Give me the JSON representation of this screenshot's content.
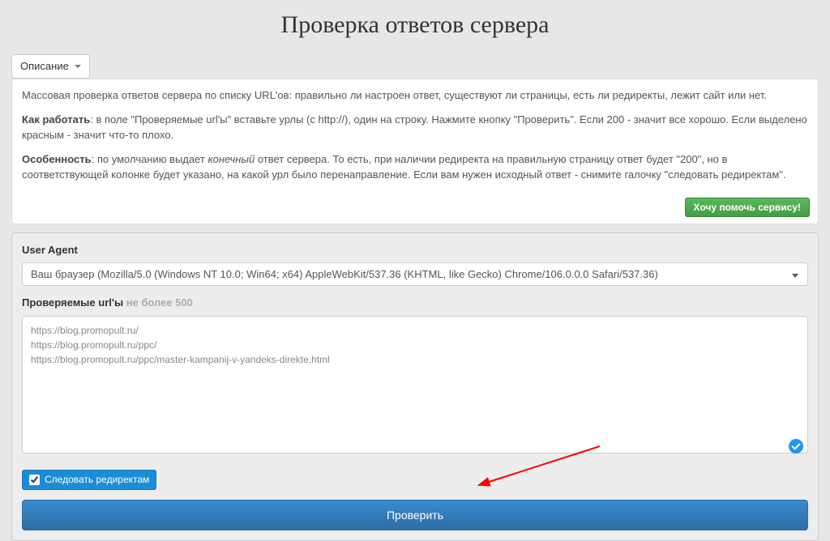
{
  "page": {
    "title": "Проверка ответов сервера"
  },
  "description": {
    "dropdown_label": "Описание",
    "p1_pre": "Массовая проверка ответов сервера по списку URL'ов: правильно ли настроен ответ, существуют ли страницы, есть ли редиректы, лежит сайт или нет.",
    "p2_bold": "Как работать",
    "p2_rest": ": в поле \"Проверяемые url'ы\" вставьте урлы (с http://), один на строку. Нажмите кнопку \"Проверить\". Если 200 - значит все хорошо. Если выделено красным - значит что-то плохо.",
    "p3_bold": "Особенность",
    "p3_pre": ": по умолчанию выдает ",
    "p3_em": "конечный",
    "p3_post": " ответ сервера. То есть, при наличии редиректа на правильную страницу ответ будет \"200\", но в соответствующей колонке будет указано, на какой урл было перенаправление. Если вам нужен исходный ответ - снимите галочку \"следовать редиректам\".",
    "help_button": "Хочу помочь сервису!"
  },
  "form": {
    "ua_label": "User Agent",
    "ua_value": "Ваш браузер (Mozilla/5.0 (Windows NT 10.0; Win64; x64) AppleWebKit/537.36 (KHTML, like Gecko) Chrome/106.0.0.0 Safari/537.36)",
    "urls_label": "Проверяемые url'ы",
    "urls_limit": "не более 500",
    "urls_value": "https://blog.promopult.ru/\nhttps://blog.promopult.ru/ppc/\nhttps://blog.promopult.ru/ppc/master-kampanij-v-yandeks-direkte.html",
    "follow_redirects": "Следовать редиректам",
    "submit": "Проверить"
  }
}
